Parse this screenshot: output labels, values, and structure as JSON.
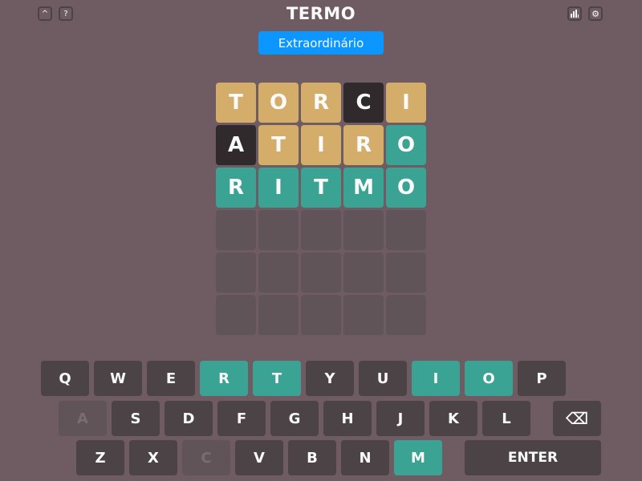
{
  "header": {
    "title": "TERMO",
    "badge": "Extraordinário",
    "icons": [
      "chevron-up-icon",
      "help-icon",
      "stats-icon",
      "settings-icon"
    ]
  },
  "colors": {
    "background": "#6e5c62",
    "correct": "#3aa394",
    "present": "#d3ad69",
    "absent": "#312a2c",
    "empty": "#615458",
    "badge": "#0c96ff",
    "key": "#4c4347"
  },
  "board": {
    "rows": [
      [
        {
          "letter": "T",
          "state": "place"
        },
        {
          "letter": "O",
          "state": "place"
        },
        {
          "letter": "R",
          "state": "place"
        },
        {
          "letter": "C",
          "state": "wrong"
        },
        {
          "letter": "I",
          "state": "place"
        }
      ],
      [
        {
          "letter": "A",
          "state": "wrong"
        },
        {
          "letter": "T",
          "state": "place"
        },
        {
          "letter": "I",
          "state": "place"
        },
        {
          "letter": "R",
          "state": "place"
        },
        {
          "letter": "O",
          "state": "right"
        }
      ],
      [
        {
          "letter": "R",
          "state": "right"
        },
        {
          "letter": "I",
          "state": "right"
        },
        {
          "letter": "T",
          "state": "right"
        },
        {
          "letter": "M",
          "state": "right"
        },
        {
          "letter": "O",
          "state": "right"
        }
      ],
      [
        {
          "letter": "",
          "state": "empty"
        },
        {
          "letter": "",
          "state": "empty"
        },
        {
          "letter": "",
          "state": "empty"
        },
        {
          "letter": "",
          "state": "empty"
        },
        {
          "letter": "",
          "state": "empty"
        }
      ],
      [
        {
          "letter": "",
          "state": "empty"
        },
        {
          "letter": "",
          "state": "empty"
        },
        {
          "letter": "",
          "state": "empty"
        },
        {
          "letter": "",
          "state": "empty"
        },
        {
          "letter": "",
          "state": "empty"
        }
      ],
      [
        {
          "letter": "",
          "state": "empty"
        },
        {
          "letter": "",
          "state": "empty"
        },
        {
          "letter": "",
          "state": "empty"
        },
        {
          "letter": "",
          "state": "empty"
        },
        {
          "letter": "",
          "state": "empty"
        }
      ]
    ]
  },
  "keyboard": {
    "rows": [
      [
        {
          "label": "Q",
          "state": "default"
        },
        {
          "label": "W",
          "state": "default"
        },
        {
          "label": "E",
          "state": "default"
        },
        {
          "label": "R",
          "state": "right"
        },
        {
          "label": "T",
          "state": "right"
        },
        {
          "label": "Y",
          "state": "default"
        },
        {
          "label": "U",
          "state": "default"
        },
        {
          "label": "I",
          "state": "right"
        },
        {
          "label": "O",
          "state": "right"
        },
        {
          "label": "P",
          "state": "default"
        }
      ],
      [
        {
          "label": "A",
          "state": "wrong"
        },
        {
          "label": "S",
          "state": "default"
        },
        {
          "label": "D",
          "state": "default"
        },
        {
          "label": "F",
          "state": "default"
        },
        {
          "label": "G",
          "state": "default"
        },
        {
          "label": "H",
          "state": "default"
        },
        {
          "label": "J",
          "state": "default"
        },
        {
          "label": "K",
          "state": "default"
        },
        {
          "label": "L",
          "state": "default"
        },
        {
          "label": "⌫",
          "state": "back"
        }
      ],
      [
        {
          "label": "Z",
          "state": "default"
        },
        {
          "label": "X",
          "state": "default"
        },
        {
          "label": "C",
          "state": "wrong"
        },
        {
          "label": "V",
          "state": "default"
        },
        {
          "label": "B",
          "state": "default"
        },
        {
          "label": "N",
          "state": "default"
        },
        {
          "label": "M",
          "state": "right"
        },
        {
          "label": "ENTER",
          "state": "enter"
        }
      ]
    ]
  }
}
